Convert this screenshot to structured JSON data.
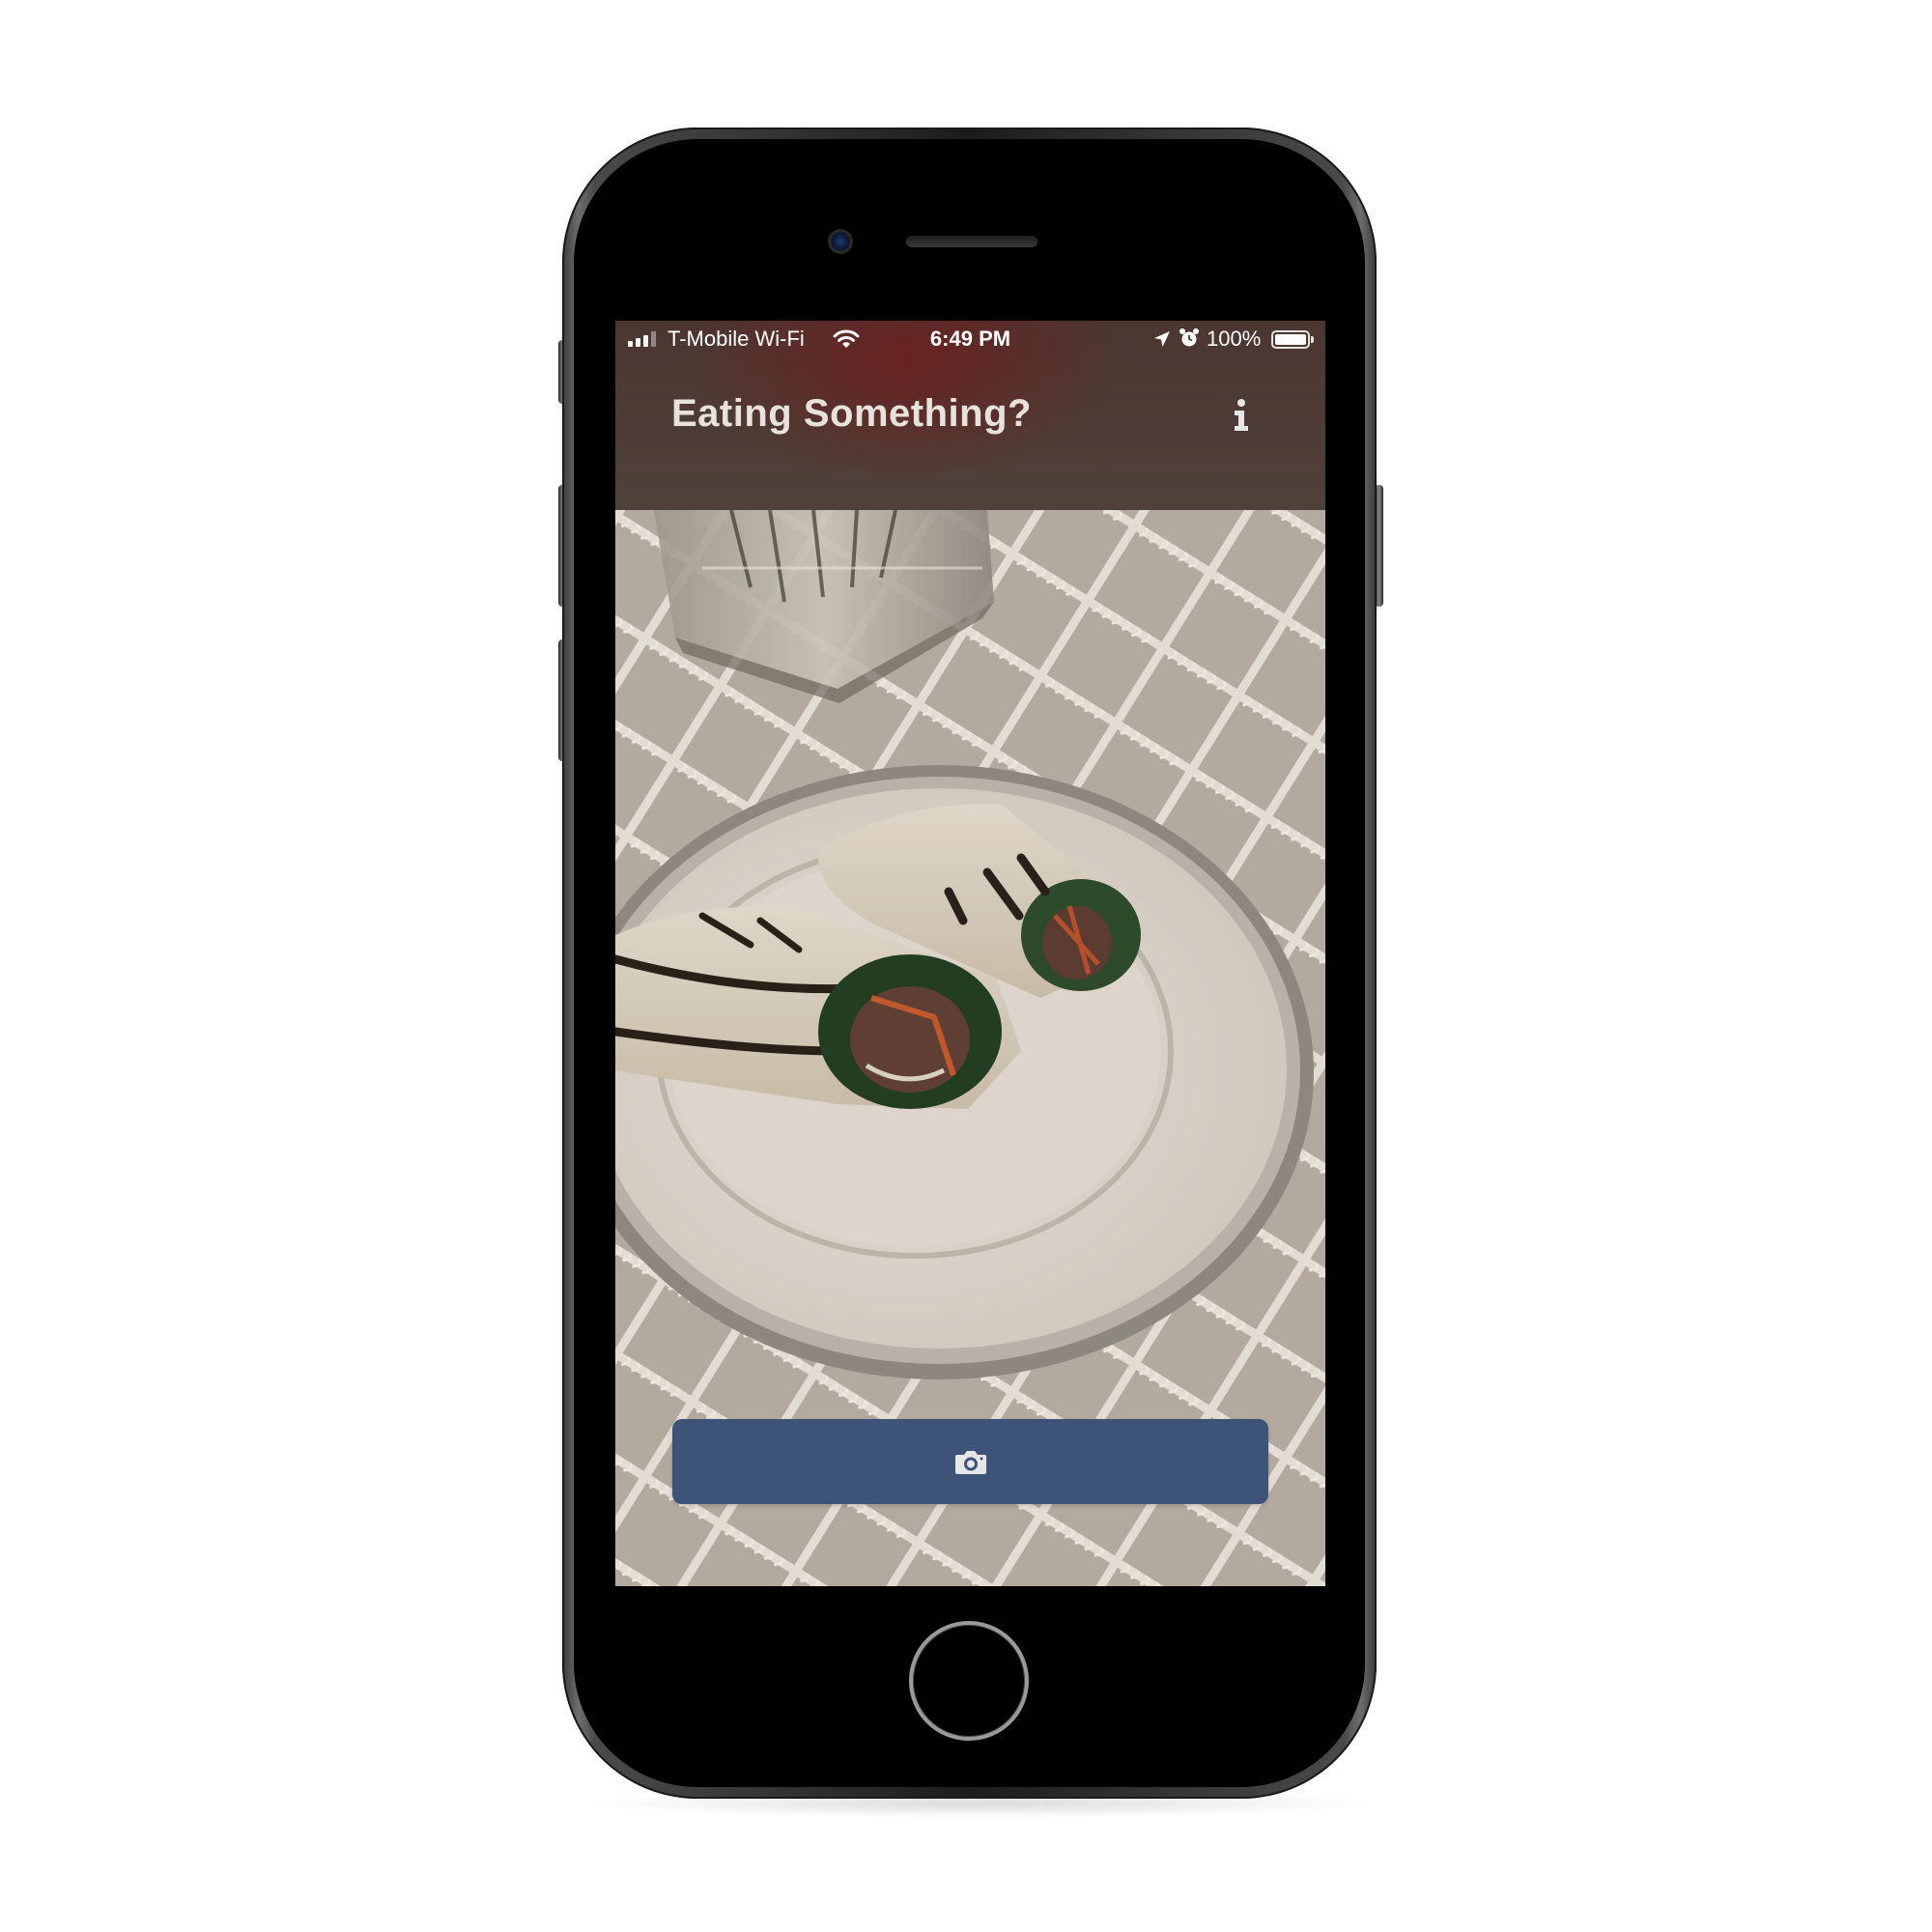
{
  "status_bar": {
    "carrier": "T-Mobile Wi-Fi",
    "time": "6:49 PM",
    "battery_percent": "100%",
    "battery_level": 1.0,
    "icons": [
      "cellular-signal-icon",
      "wifi-icon",
      "location-arrow-icon",
      "alarm-clock-icon",
      "battery-icon"
    ]
  },
  "nav": {
    "title": "Eating Something?",
    "info_icon": "info-icon"
  },
  "main": {
    "photo_description_icon": "food-photo",
    "capture_button_icon": "camera-icon"
  },
  "colors": {
    "nav_background": "#4e3d36",
    "title_text": "#e7e2dc",
    "capture_button": "#3d5377",
    "icon": "#e6e6e6"
  }
}
